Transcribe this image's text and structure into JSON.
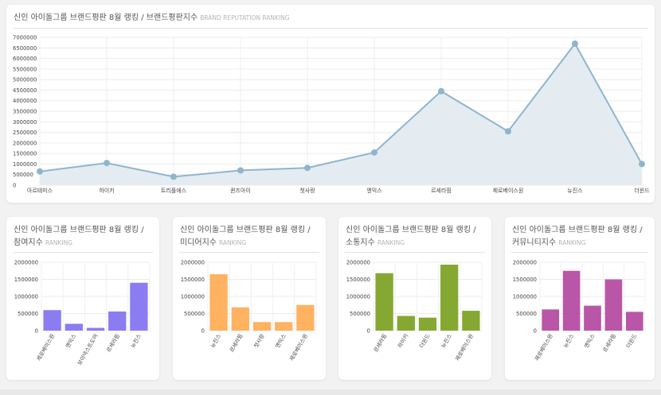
{
  "main": {
    "title": "신인 아이돌그룹 브랜드평판 8월 랭킹 / 브랜드평판지수",
    "subtitle": "BRAND REPUTATION RANKING"
  },
  "small_cards": [
    {
      "title_line1": "신인 아이돌그룹 브랜드평판 8월 랭킹 /",
      "title_line2": "참여지수",
      "subtitle": "RANKING"
    },
    {
      "title_line1": "신인 아이돌그룹 브랜드평판 8월 랭킹 /",
      "title_line2": "미디어지수",
      "subtitle": "RANKING"
    },
    {
      "title_line1": "신인 아이돌그룹 브랜드평판 8월 랭킹 /",
      "title_line2": "소통지수",
      "subtitle": "RANKING"
    },
    {
      "title_line1": "신인 아이돌그룹 브랜드평판 8월 랭킹 /",
      "title_line2": "커뮤니티지수",
      "subtitle": "RANKING"
    }
  ],
  "chart_data": [
    {
      "type": "area",
      "categories": [
        "아르테미스",
        "하이키",
        "트리플에스",
        "퀸즈아이",
        "첫사랑",
        "엔믹스",
        "르세라핌",
        "제로베이스원",
        "뉴진스",
        "더윈드"
      ],
      "values": [
        650000,
        1050000,
        400000,
        700000,
        820000,
        1550000,
        4450000,
        2550000,
        6700000,
        1000000
      ],
      "yticks": [
        0,
        500000,
        1000000,
        1500000,
        2000000,
        2500000,
        3000000,
        3500000,
        4000000,
        4500000,
        5000000,
        5500000,
        6000000,
        6500000,
        7000000
      ],
      "ylim": [
        0,
        7000000
      ],
      "color": "#8fb5cc",
      "fill": "#e4ecf2",
      "grid": true
    },
    {
      "type": "bar",
      "categories": [
        "제로베이스원",
        "엔믹스",
        "보이넥스트도어",
        "르세라핌",
        "뉴진스"
      ],
      "values": [
        600000,
        200000,
        80000,
        560000,
        1400000
      ],
      "yticks": [
        0,
        500000,
        1000000,
        1500000,
        2000000
      ],
      "ylim": [
        0,
        2000000
      ],
      "color": "#8c7cf2",
      "grid": true
    },
    {
      "type": "bar",
      "categories": [
        "뉴진스",
        "르세라핌",
        "첫사랑",
        "엔믹스",
        "제로베이스원"
      ],
      "values": [
        1650000,
        680000,
        250000,
        250000,
        750000
      ],
      "yticks": [
        0,
        500000,
        1000000,
        1500000,
        2000000
      ],
      "ylim": [
        0,
        2000000
      ],
      "color": "#ffb260",
      "grid": true
    },
    {
      "type": "bar",
      "categories": [
        "르세라핌",
        "하이키",
        "더윈드",
        "뉴진스",
        "제로베이스원"
      ],
      "values": [
        1680000,
        430000,
        380000,
        1930000,
        580000
      ],
      "yticks": [
        0,
        500000,
        1000000,
        1500000,
        2000000
      ],
      "ylim": [
        0,
        2000000
      ],
      "color": "#85a832",
      "grid": true
    },
    {
      "type": "bar",
      "categories": [
        "제로베이스원",
        "뉴진스",
        "엔믹스",
        "르세라핌",
        "더윈드"
      ],
      "values": [
        620000,
        1750000,
        730000,
        1500000,
        550000
      ],
      "yticks": [
        0,
        500000,
        1000000,
        1500000,
        2000000
      ],
      "ylim": [
        0,
        2000000
      ],
      "color": "#b956a8",
      "grid": true
    }
  ]
}
